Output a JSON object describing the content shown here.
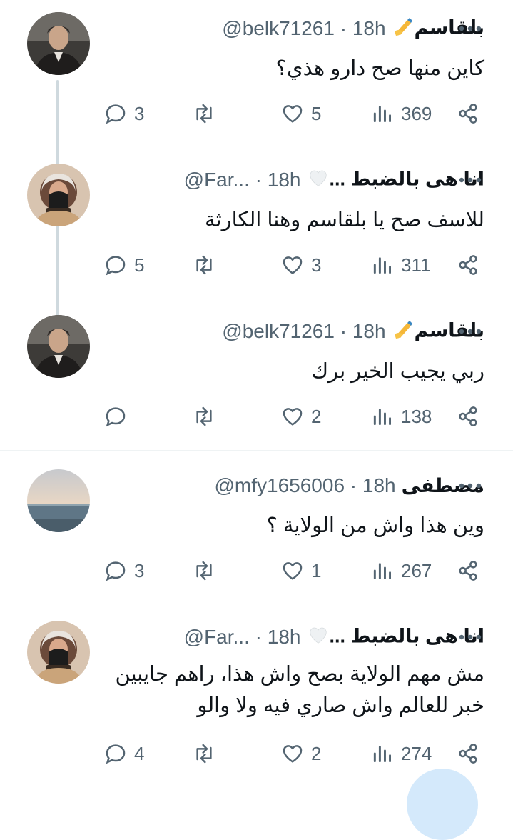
{
  "replies": [
    {
      "name": "بلقاسم",
      "handle": "@belk71261 · 18h",
      "text": "كاين منها صح دارو هذي؟",
      "replies": "3",
      "likes": "5",
      "views": "369",
      "avatar": "man",
      "emoji": "writing-hand"
    },
    {
      "name": "انا هى بالضبط ...",
      "handle": "@Far... · 18h",
      "text": "للاسف صح يا بلقاسم وهنا الكارثة",
      "replies": "5",
      "likes": "3",
      "views": "311",
      "avatar": "woman",
      "emoji": "white-heart"
    },
    {
      "name": "بلقاسم",
      "handle": "@belk71261 · 18h",
      "text": "ربي يجيب الخير برك",
      "replies": "",
      "likes": "2",
      "views": "138",
      "avatar": "man",
      "emoji": "writing-hand"
    },
    {
      "name": "مصطفى",
      "handle": "@mfy1656006 · 18h",
      "text": "وين هذا واش من الولاية ؟",
      "replies": "3",
      "likes": "1",
      "views": "267",
      "avatar": "sea",
      "emoji": ""
    },
    {
      "name": "انا هى بالضبط ...",
      "handle": "@Far... · 18h",
      "text": "مش مهم الولاية بصح واش هذا، راهم جايبين خبر للعالم واش صاري فيه ولا والو",
      "replies": "4",
      "likes": "2",
      "views": "274",
      "avatar": "woman",
      "emoji": "white-heart"
    }
  ],
  "icons": {
    "reply": "reply-icon",
    "retweet": "retweet-icon",
    "like": "like-icon",
    "views": "views-icon",
    "share": "share-icon",
    "more": "more-icon"
  },
  "colors": {
    "secondary_text": "#536471",
    "thread_line": "#cfd9de",
    "divider": "#eff3f4"
  }
}
